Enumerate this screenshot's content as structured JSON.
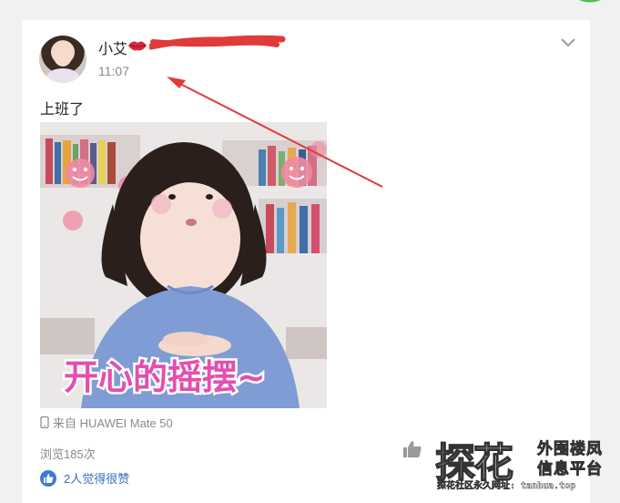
{
  "post": {
    "user_name": "小艾",
    "time": "11:07",
    "text": "上班了",
    "image_caption": "开心的摇摆~",
    "device": "来自 HUAWEI Mate 50",
    "views": "浏览185次",
    "likes": "2人觉得很赞"
  },
  "watermark": {
    "big": "探花",
    "line1": "外围楼凤",
    "line2": "信息平台",
    "url": "探花社区永久网址: tanhua.top"
  },
  "colors": {
    "annotation_red": "#e03a3a",
    "like_blue": "#3e7ad6",
    "caption_pink": "#e24fb0"
  },
  "icons": [
    "lips-icon",
    "chevron-down-icon",
    "phone-icon",
    "thumbs-up-icon",
    "like-badge-icon"
  ]
}
